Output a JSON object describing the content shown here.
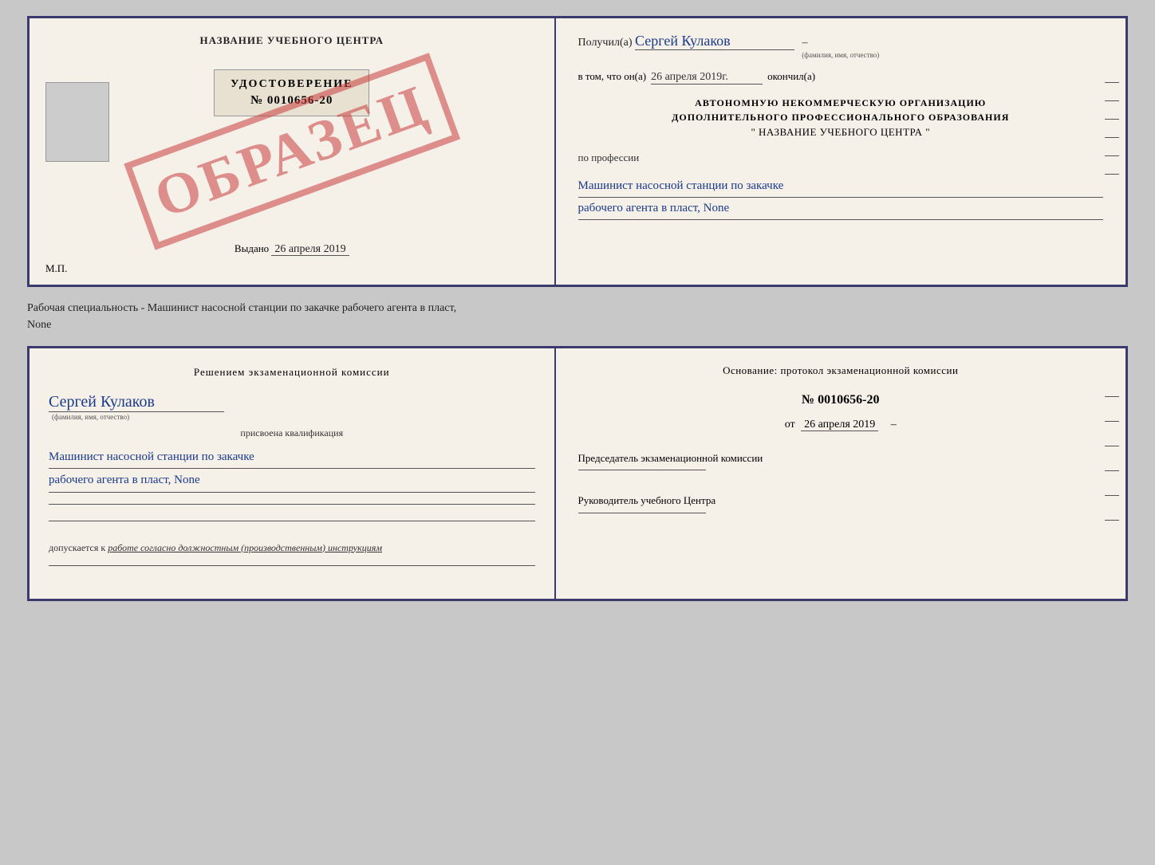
{
  "top_cert": {
    "left": {
      "title": "НАЗВАНИЕ УЧЕБНОГО ЦЕНТРА",
      "stamp": "ОБРАЗЕЦ",
      "udostoverenie": "УДОСТОВЕРЕНИЕ",
      "number": "№ 0010656-20",
      "vydano_label": "Выдано",
      "vydano_date": "26 апреля 2019",
      "mp": "М.П."
    },
    "right": {
      "poluchil_label": "Получил(а)",
      "poluchil_value": "Сергей Кулаков",
      "fio_hint": "(фамилия, имя, отчество)",
      "vtom_label": "в том, что он(а)",
      "vtom_date": "26 апреля 2019г.",
      "okonchil_label": "окончил(а)",
      "org_line1": "АВТОНОМНУЮ НЕКОММЕРЧЕСКУЮ ОРГАНИЗАЦИЮ",
      "org_line2": "ДОПОЛНИТЕЛЬНОГО ПРОФЕССИОНАЛЬНОГО ОБРАЗОВАНИЯ",
      "org_line3": "\"  НАЗВАНИЕ УЧЕБНОГО ЦЕНТРА  \"",
      "po_professii": "по профессии",
      "profession_line1": "Машинист насосной станции по закачке",
      "profession_line2": "рабочего агента в пласт, None"
    }
  },
  "specialty_text": "Рабочая специальность - Машинист насосной станции по закачке рабочего агента в пласт,",
  "specialty_text2": "None",
  "bottom_cert": {
    "left": {
      "resheniem": "Решением экзаменационной комиссии",
      "name_value": "Сергей Кулаков",
      "fio_hint": "(фамилия, имя, отчество)",
      "prisvoena": "присвоена квалификация",
      "kvali_line1": "Машинист насосной станции по закачке",
      "kvali_line2": "рабочего агента в пласт, None",
      "dopuskaetsya_prefix": "допускается к",
      "dopuskaetsya_value": "работе согласно должностным (производственным) инструкциям"
    },
    "right": {
      "osnovanie": "Основание: протокол экзаменационной комиссии",
      "number": "№ 0010656-20",
      "ot_label": "от",
      "ot_date": "26 апреля 2019",
      "predsedatel": "Председатель экзаменационной комиссии",
      "rukovoditel": "Руководитель учебного Центра"
    }
  }
}
